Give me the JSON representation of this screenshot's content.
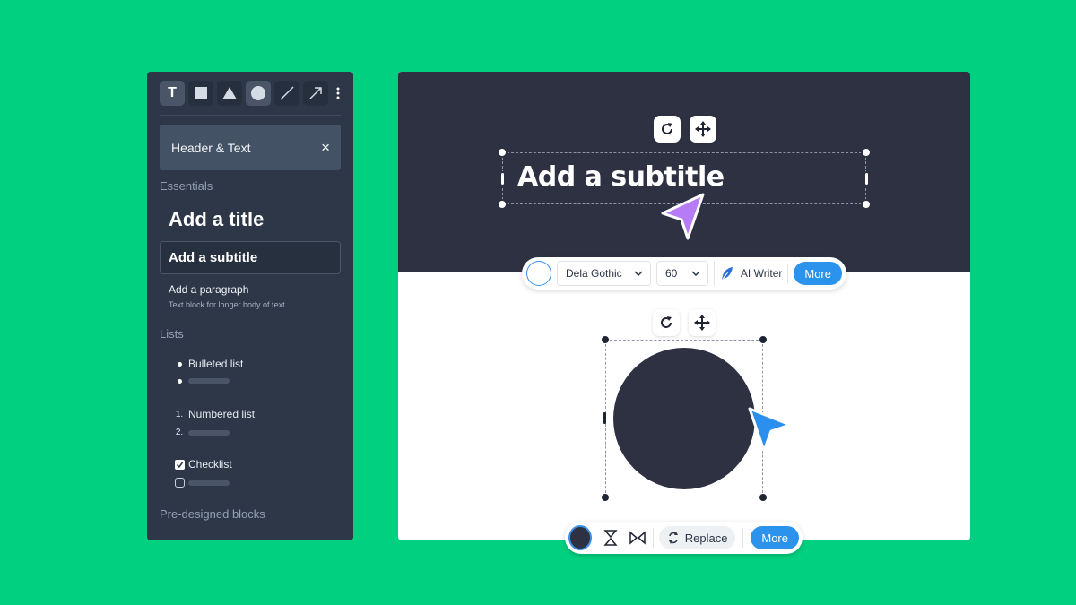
{
  "panel": {
    "tools": [
      "text-tool",
      "rectangle-tool",
      "triangle-tool",
      "circle-tool",
      "line-tool",
      "arrow-tool"
    ],
    "text_tool_glyph": "T",
    "header_chip": {
      "label": "Header & Text",
      "close": "×"
    },
    "essentials_label": "Essentials",
    "title_item": "Add a title",
    "subtitle_item": "Add a subtitle",
    "paragraph_item": {
      "title": "Add a paragraph",
      "subtitle": "Text block for longer body of text"
    },
    "lists_label": "Lists",
    "bulleted_label": "Bulleted list",
    "numbered_label": "Numbered list",
    "numbered_marks": [
      "1.",
      "2."
    ],
    "checklist_label": "Checklist",
    "predesigned_label": "Pre-designed blocks"
  },
  "canvas": {
    "subtitle_text": "Add a subtitle"
  },
  "text_toolbar": {
    "font": "Dela Gothic",
    "size": "60",
    "ai_writer": "AI Writer",
    "more": "More"
  },
  "shape_toolbar": {
    "replace": "Replace",
    "more": "More"
  },
  "colors": {
    "background": "#00d07f",
    "panel": "#2d3748",
    "canvas_dark": "#2d3142",
    "accent_blue": "#2c93ec",
    "cursor_purple": "#b57cf5",
    "cursor_blue": "#2b8ff0"
  }
}
